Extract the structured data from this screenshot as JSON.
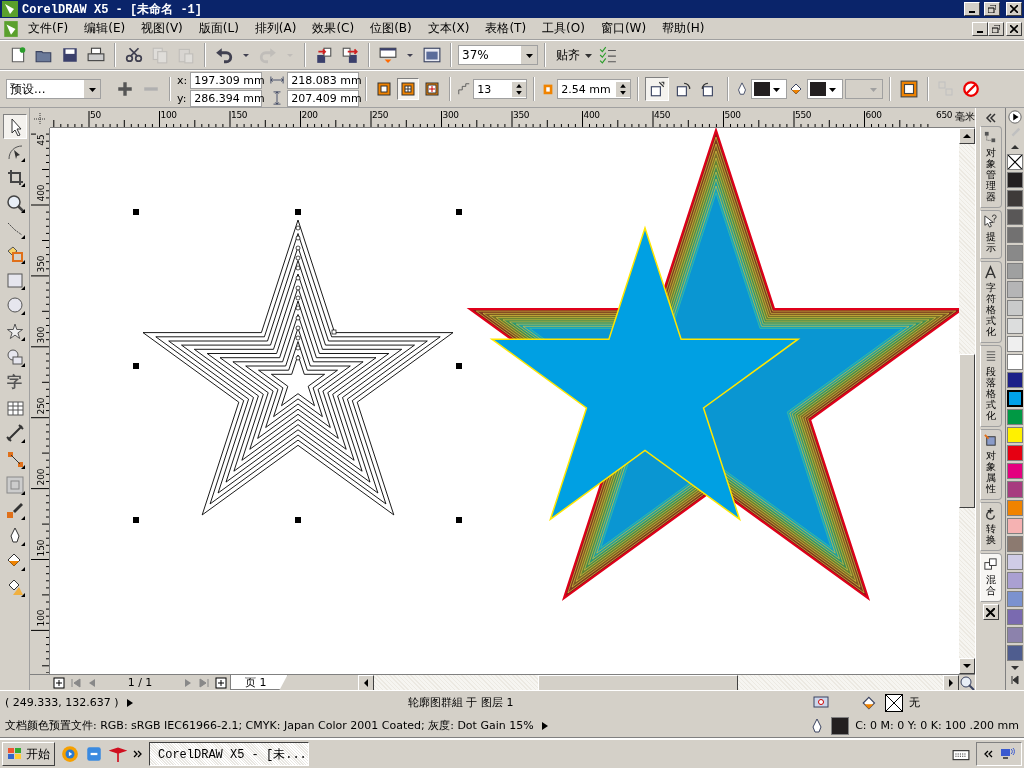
{
  "window": {
    "title": "CorelDRAW X5 - [未命名 -1]"
  },
  "menu": [
    "文件(F)",
    "编辑(E)",
    "视图(V)",
    "版面(L)",
    "排列(A)",
    "效果(C)",
    "位图(B)",
    "文本(X)",
    "表格(T)",
    "工具(O)",
    "窗口(W)",
    "帮助(H)"
  ],
  "standard_toolbar": {
    "groups": [
      [
        {
          "kind": "new",
          "disabled": false
        },
        {
          "kind": "open",
          "disabled": false
        },
        {
          "kind": "save",
          "disabled": false
        },
        {
          "kind": "print",
          "disabled": false
        }
      ],
      [
        {
          "kind": "cut",
          "disabled": false
        },
        {
          "kind": "copy",
          "disabled": true
        },
        {
          "kind": "paste",
          "disabled": true
        }
      ],
      [
        {
          "kind": "undo",
          "disabled": false
        },
        {
          "kind": "caret",
          "disabled": false
        },
        {
          "kind": "redo",
          "disabled": true
        },
        {
          "kind": "caret",
          "disabled": true
        }
      ],
      [
        {
          "kind": "import",
          "disabled": false
        },
        {
          "kind": "export",
          "disabled": false
        }
      ],
      [
        {
          "kind": "launcher",
          "disabled": false
        },
        {
          "kind": "caret",
          "disabled": false
        },
        {
          "kind": "welcome",
          "disabled": false
        }
      ]
    ],
    "zoom": "37%",
    "snap": "贴齐"
  },
  "property_bar": {
    "preset": "预设...",
    "remove_disabled": true,
    "x": {
      "label": "x:",
      "value": "197.309 mm"
    },
    "y": {
      "label": "y:",
      "value": "286.394 mm"
    },
    "width": "218.083 mm",
    "height": "207.409 mm",
    "directions": [
      {
        "kind": "center",
        "selected": false
      },
      {
        "kind": "inside",
        "selected": true
      },
      {
        "kind": "outside",
        "selected": false
      }
    ],
    "steps": "13",
    "offset": "2.54 mm",
    "blends": [
      {
        "kind": "linear",
        "selected": true
      },
      {
        "kind": "clockwise",
        "selected": false
      },
      {
        "kind": "counterclockwise",
        "selected": false
      }
    ],
    "copy_disabled": true
  },
  "toolbox": [
    {
      "kind": "pick",
      "selected": true,
      "flyout": false
    },
    {
      "kind": "shape",
      "selected": false,
      "flyout": true
    },
    {
      "kind": "crop",
      "selected": false,
      "flyout": true
    },
    {
      "kind": "zoom",
      "selected": false,
      "flyout": true
    },
    {
      "kind": "curve",
      "selected": false,
      "flyout": true
    },
    {
      "kind": "smart",
      "selected": false,
      "flyout": true
    },
    {
      "kind": "rectangle",
      "selected": false,
      "flyout": true
    },
    {
      "kind": "ellipse",
      "selected": false,
      "flyout": true
    },
    {
      "kind": "star",
      "selected": false,
      "flyout": true
    },
    {
      "kind": "shapes",
      "selected": false,
      "flyout": true
    },
    {
      "kind": "text",
      "label": "字",
      "selected": false,
      "flyout": false
    },
    {
      "kind": "table",
      "selected": false,
      "flyout": false
    },
    {
      "kind": "dimension",
      "selected": false,
      "flyout": true
    },
    {
      "kind": "connector",
      "selected": false,
      "flyout": true
    },
    {
      "kind": "contour",
      "selected": false,
      "flyout": true
    },
    {
      "kind": "eyedropper",
      "selected": false,
      "flyout": true
    },
    {
      "kind": "outline",
      "selected": false,
      "flyout": true
    },
    {
      "kind": "fill",
      "selected": false,
      "flyout": true
    },
    {
      "kind": "interactive-fill",
      "selected": false,
      "flyout": true
    }
  ],
  "rulers": {
    "horizontal": [
      "50",
      "100",
      "150",
      "200",
      "250",
      "300",
      "350",
      "400",
      "450",
      "500",
      "550",
      "600",
      "650"
    ],
    "unit": "毫米",
    "vertical": [
      "45",
      "400",
      "350",
      "300",
      "250",
      "200",
      "150",
      "100"
    ]
  },
  "page_nav": {
    "counter": "1 / 1",
    "tab": "页 1"
  },
  "dockers": [
    {
      "kind": "objects",
      "label": "对象管理器",
      "selected": false
    },
    {
      "kind": "hints",
      "label": "提示",
      "selected": false
    },
    {
      "kind": "character",
      "label": "字符格式化",
      "selected": false
    },
    {
      "kind": "paragraph",
      "label": "段落格式化",
      "selected": false
    },
    {
      "kind": "properties",
      "label": "对象属性",
      "selected": false
    },
    {
      "kind": "transform",
      "label": "转换",
      "selected": false
    },
    {
      "kind": "blend",
      "label": "混合",
      "selected": true
    }
  ],
  "palette": [
    {
      "kind": "none",
      "selected": false
    },
    {
      "color": "#231f20",
      "selected": false
    },
    {
      "color": "#3e3a39",
      "selected": false
    },
    {
      "color": "#595757",
      "selected": false
    },
    {
      "color": "#727171",
      "selected": false
    },
    {
      "color": "#898989",
      "selected": false
    },
    {
      "color": "#9fa0a0",
      "selected": false
    },
    {
      "color": "#b5b5b6",
      "selected": false
    },
    {
      "color": "#c9caca",
      "selected": false
    },
    {
      "color": "#dcdddd",
      "selected": false
    },
    {
      "color": "#efefef",
      "selected": false
    },
    {
      "color": "#ffffff",
      "selected": false
    },
    {
      "color": "#1d2088",
      "selected": false
    },
    {
      "color": "#00a0e9",
      "selected": true
    },
    {
      "color": "#009944",
      "selected": false
    },
    {
      "color": "#fff100",
      "selected": false
    },
    {
      "color": "#e60012",
      "selected": false
    },
    {
      "color": "#e4007f",
      "selected": false
    },
    {
      "color": "#a73b7f",
      "selected": false
    },
    {
      "color": "#f08300",
      "selected": false
    },
    {
      "color": "#f5b2b2",
      "selected": false
    },
    {
      "color": "#8c7a70",
      "selected": false
    },
    {
      "color": "#cfcce6",
      "selected": false
    },
    {
      "color": "#aaa0d2",
      "selected": false
    },
    {
      "color": "#7b92cf",
      "selected": false
    },
    {
      "color": "#7a6ab0",
      "selected": false
    },
    {
      "color": "#8c82ac",
      "selected": false
    },
    {
      "color": "#4f5d8f",
      "selected": false
    }
  ],
  "status": {
    "coords": "( 249.333, 132.637 )",
    "selection": "轮廓图群組 于 图层 1",
    "profile": "文档颜色预置文件: RGB: sRGB IEC61966-2.1; CMYK: Japan Color 2001 Coated; 灰度: Dot Gain 15%",
    "fill": "无",
    "outline": "C: 0 M: 0 Y: 0 K:  100  .200 mm"
  },
  "taskbar": {
    "start": "开始",
    "task": "CorelDRAW X5 - [未..."
  }
}
